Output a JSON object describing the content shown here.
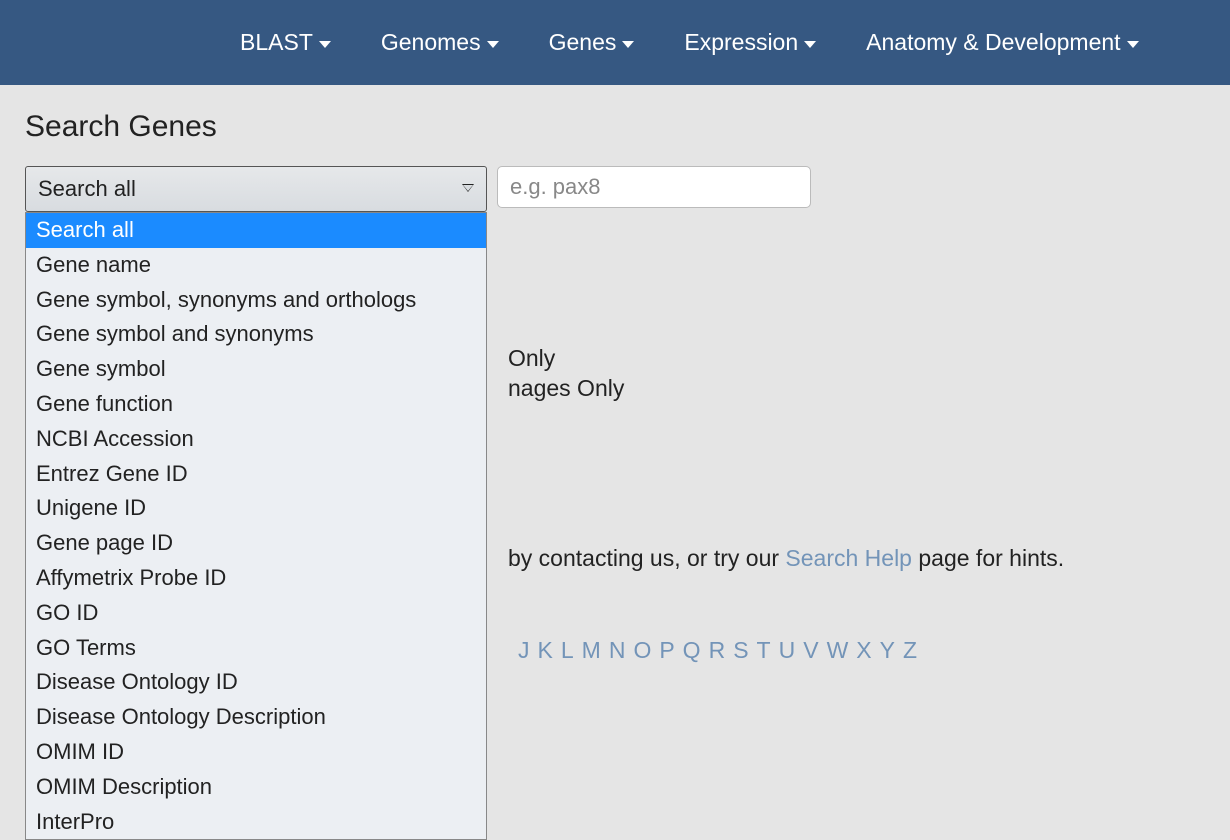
{
  "navbar": {
    "items": [
      {
        "label": "BLAST"
      },
      {
        "label": "Genomes"
      },
      {
        "label": "Genes"
      },
      {
        "label": "Expression"
      },
      {
        "label": "Anatomy & Development"
      }
    ]
  },
  "page": {
    "title": "Search Genes"
  },
  "search": {
    "selected": "Search all",
    "placeholder": "e.g. pax8",
    "value": "",
    "options": [
      "Search all",
      "Gene name",
      "Gene symbol, synonyms and orthologs",
      "Gene symbol and synonyms",
      "Gene symbol",
      "Gene function",
      "NCBI Accession",
      "Entrez Gene ID",
      "Unigene ID",
      "Gene page ID",
      "Affymetrix Probe ID",
      "GO ID",
      "GO Terms",
      "Disease Ontology ID",
      "Disease Ontology Description",
      "OMIM ID",
      "OMIM Description",
      "InterPro"
    ]
  },
  "partial": {
    "only": "Only",
    "images_only": "nages Only"
  },
  "help": {
    "prefix": "by contacting us, or try our ",
    "link": "Search Help",
    "suffix": " page for hints."
  },
  "alpha": [
    "J",
    "K",
    "L",
    "M",
    "N",
    "O",
    "P",
    "Q",
    "R",
    "S",
    "T",
    "U",
    "V",
    "W",
    "X",
    "Y",
    "Z"
  ]
}
